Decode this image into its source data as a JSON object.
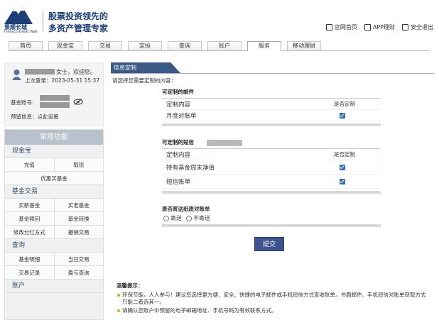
{
  "header": {
    "brand_cn": "景顺长城",
    "brand_en": "Invesco Great Wall",
    "slogan_line1": "股票投资领先的",
    "slogan_line2": "多资产管理专家",
    "top_links": [
      "官网首页",
      "APP理财",
      "安全退出"
    ]
  },
  "nav": {
    "tabs": [
      "首页",
      "现金宝",
      "交易",
      "定投",
      "查询",
      "账户",
      "服务",
      "移动理财"
    ],
    "active": "服务"
  },
  "user": {
    "greeting": "女士，欢迎您。",
    "last_login": "上次登录：2023-05-31 15:37",
    "account_label": "基金账号：",
    "reserve_label": "预留信息：",
    "reserve_link": "点此设置"
  },
  "menu": {
    "header": "常用功能",
    "sections": [
      {
        "title": "现金宝",
        "rows": [
          [
            "充值",
            "取现"
          ],
          [
            "优惠买基金"
          ]
        ]
      },
      {
        "title": "基金交易",
        "rows": [
          [
            "买新基金",
            "买老基金"
          ],
          [
            "基金赎回",
            "基金转换"
          ],
          [
            "修改分红方式",
            "撤销交易"
          ]
        ]
      },
      {
        "title": "查询",
        "rows": [
          [
            "基金明细",
            "当日交易"
          ],
          [
            "交易记录",
            "盈亏查询"
          ]
        ]
      },
      {
        "title": "账户",
        "rows": []
      }
    ]
  },
  "main": {
    "section_title": "信息定制",
    "intro": "请选择您需要定制的内容：",
    "email_group": {
      "title": "可定制的邮件",
      "header_left": "定制内容",
      "header_right": "是否定制",
      "items": [
        {
          "label": "月度对账单",
          "checked": true
        }
      ]
    },
    "sms_group": {
      "title": "可定制的短信",
      "header_left": "定制内容",
      "header_right": "是否定制",
      "items": [
        {
          "label": "持有基金周末净值",
          "checked": true
        },
        {
          "label": "短信账单",
          "checked": true
        }
      ]
    },
    "paper": {
      "question": "是否寄送纸质对账单",
      "options": [
        "寄送",
        "不寄送"
      ]
    },
    "submit_label": "提交"
  },
  "tips": {
    "title": "温馨提示：",
    "items": [
      "环保节能，人人参与！建议您选择更方便、安全、快捷的电子邮件或手机短信方式查收账单。书面邮件、手机短信对账单获取方式只能二者选其一。",
      "请确认您账户中预留的电子邮箱地址、手机号码为有效联系方式。"
    ]
  },
  "colors": {
    "brand_blue": "#1c3f7a",
    "title_bar": "#3b5b86",
    "checkbox": "#2f6fb7",
    "submit": "#3f548e",
    "tip_dot": "#f0a000"
  }
}
